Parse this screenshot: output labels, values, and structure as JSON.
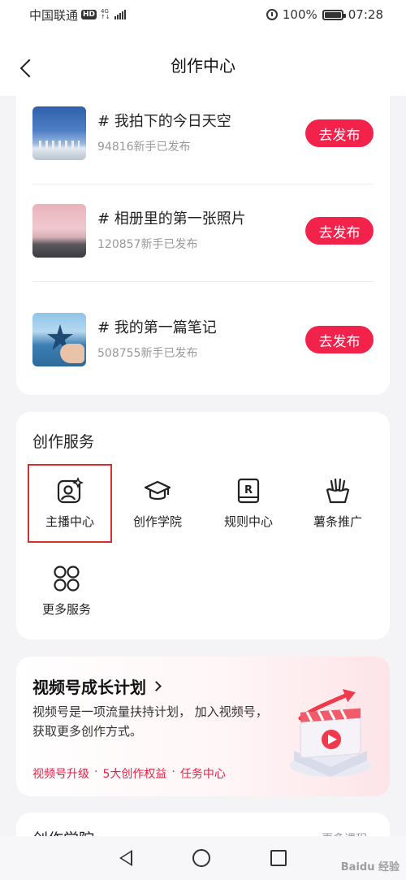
{
  "status_bar": {
    "carrier": "中国联通",
    "hd": "HD",
    "network_top": "4G",
    "network_bottom": "↑↓",
    "battery": "100%",
    "time": "07:28"
  },
  "header": {
    "title": "创作中心"
  },
  "topics": [
    {
      "title": "# 我拍下的今日天空",
      "count": "94816新手已发布",
      "button": "去发布",
      "thumb": "sky"
    },
    {
      "title": "# 相册里的第一张照片",
      "count": "120857新手已发布",
      "button": "去发布",
      "thumb": "pink-sky"
    },
    {
      "title": "# 我的第一篇笔记",
      "count": "508755新手已发布",
      "button": "去发布",
      "thumb": "starfish"
    }
  ],
  "services": {
    "title": "创作服务",
    "items": [
      {
        "label": "主播中心",
        "icon": "anchor-profile-icon"
      },
      {
        "label": "创作学院",
        "icon": "graduation-cap-icon"
      },
      {
        "label": "规则中心",
        "icon": "rule-book-icon"
      },
      {
        "label": "薯条推广",
        "icon": "fries-icon"
      },
      {
        "label": "更多服务",
        "icon": "grid-circles-icon"
      }
    ]
  },
  "growth": {
    "title": "视频号成长计划",
    "desc": "视频号是一项流量扶持计划， 加入视频号，获取更多创作方式。",
    "link1": "视频号升级",
    "link2": "5大创作权益",
    "link3": "任务中心",
    "separator": "·"
  },
  "bottom_card": {
    "title": "创作学院",
    "more": "更多课程"
  },
  "watermark": "Baidu 经验",
  "colors": {
    "accent": "#f2224b",
    "highlight": "#d62f2f",
    "link": "#e02447"
  }
}
